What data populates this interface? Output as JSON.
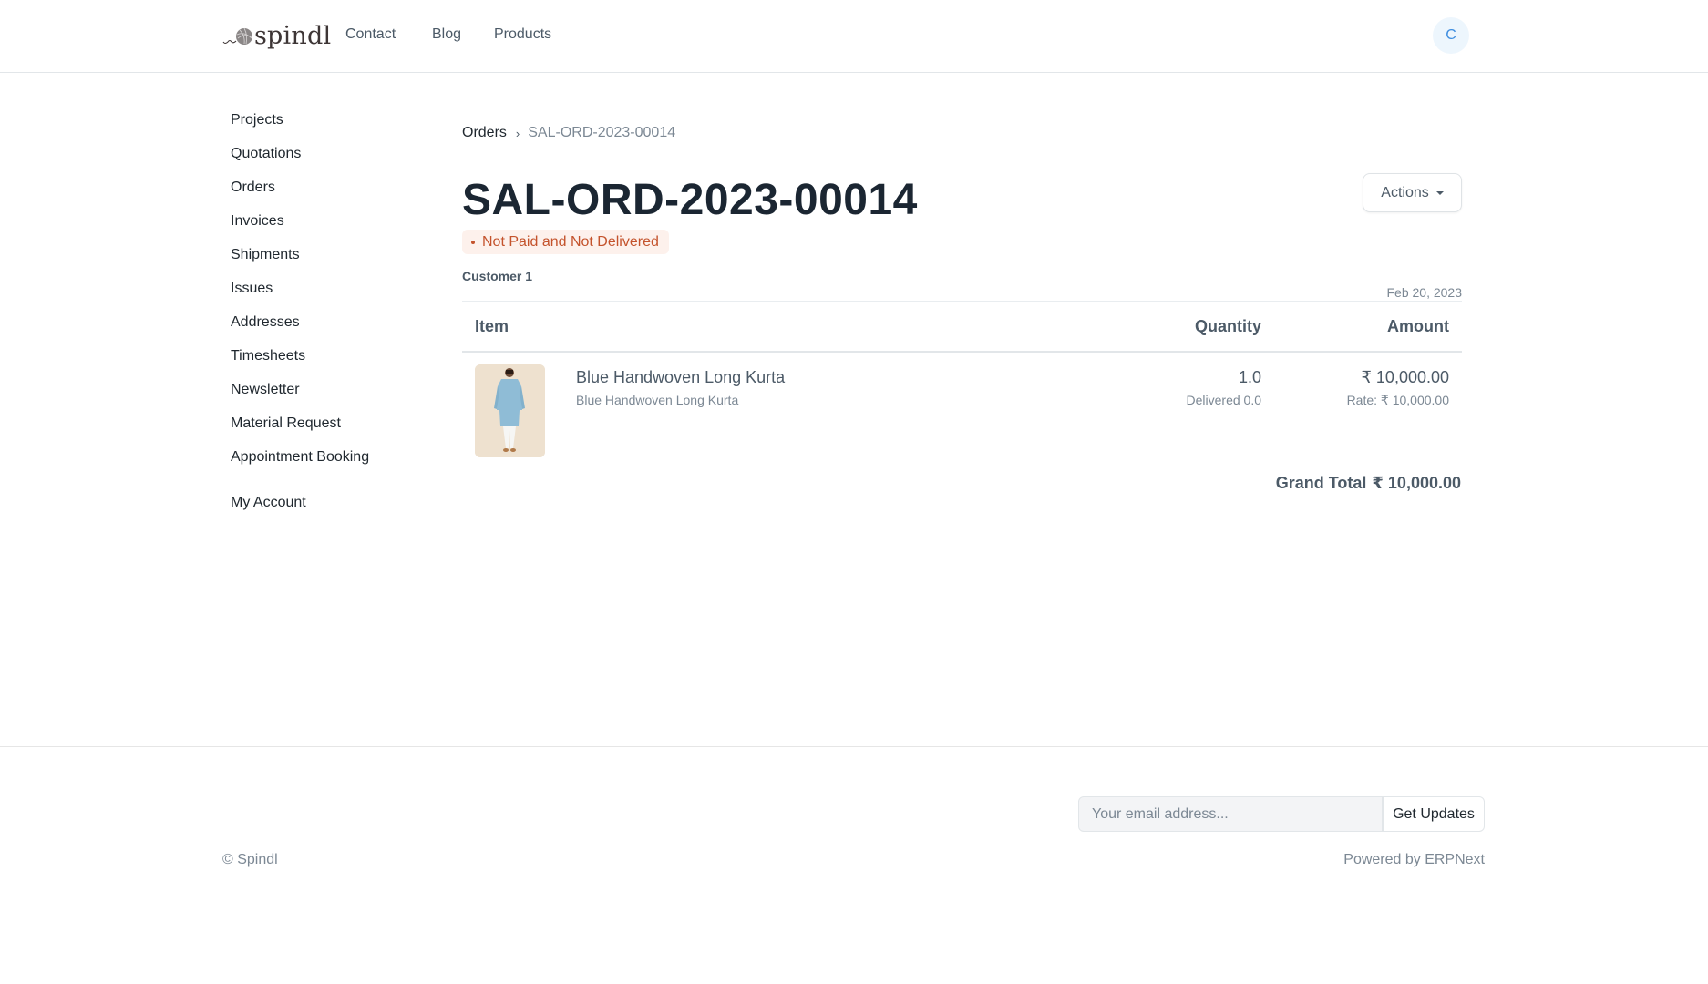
{
  "header": {
    "brand": "spindl",
    "nav": [
      {
        "label": "Contact"
      },
      {
        "label": "Blog"
      },
      {
        "label": "Products"
      }
    ],
    "avatar_initial": "C"
  },
  "sidebar": {
    "items": [
      {
        "label": "Projects"
      },
      {
        "label": "Quotations"
      },
      {
        "label": "Orders"
      },
      {
        "label": "Invoices"
      },
      {
        "label": "Shipments"
      },
      {
        "label": "Issues"
      },
      {
        "label": "Addresses"
      },
      {
        "label": "Timesheets"
      },
      {
        "label": "Newsletter"
      },
      {
        "label": "Material Request"
      },
      {
        "label": "Appointment Booking"
      }
    ],
    "account": "My Account"
  },
  "breadcrumb": {
    "parent": "Orders",
    "separator": "›",
    "current": "SAL-ORD-2023-00014"
  },
  "order": {
    "title": "SAL-ORD-2023-00014",
    "status": "Not Paid and Not Delivered",
    "status_color": "#c4532c",
    "date": "Feb 20, 2023",
    "customer": "Customer 1",
    "actions_label": "Actions"
  },
  "table": {
    "columns": {
      "item": "Item",
      "quantity": "Quantity",
      "amount": "Amount"
    },
    "rows": [
      {
        "image_icon": "blue-kurta-product-image",
        "name": "Blue Handwoven Long Kurta",
        "description": "Blue Handwoven Long Kurta",
        "quantity": "1.0",
        "delivered": "Delivered 0.0",
        "amount": "₹ 10,000.00",
        "rate": "Rate: ₹ 10,000.00"
      }
    ]
  },
  "totals": {
    "grand_total_label": "Grand Total",
    "grand_total_value": "₹ 10,000.00"
  },
  "footer": {
    "email_placeholder": "Your email address...",
    "email_value": "",
    "subscribe_label": "Get Updates",
    "copyright": "© Spindl",
    "powered_prefix": "Powered by ",
    "powered_link": "ERPNext"
  }
}
